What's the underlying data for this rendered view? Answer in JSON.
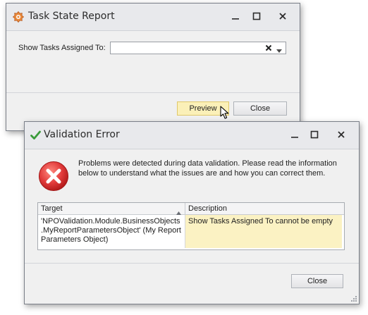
{
  "task_window": {
    "title": "Task State Report",
    "field_label": "Show Tasks Assigned To:",
    "field_value": "",
    "preview_label": "Preview",
    "close_label": "Close"
  },
  "validation_window": {
    "title": "Validation Error",
    "message": "Problems were detected during data validation. Please read the information below to understand what the issues are and how you can correct them.",
    "columns": [
      "Target",
      "Description"
    ],
    "rows": [
      {
        "target": "'NPOValidation.Module.BusinessObjects.MyReportParametersObject' (My Report Parameters Object)",
        "description": "Show Tasks Assigned To cannot be empty"
      }
    ],
    "close_label": "Close"
  },
  "colors": {
    "title_bar": "#e8e9ec",
    "window_body": "#f0f0f0",
    "highlight_row": "#fbf2c3",
    "preview_hover": "#fbf0b8",
    "error_red": "#e23b3b",
    "check_green": "#3a9b3a"
  },
  "icons": {
    "app": "gear-app-icon",
    "validation": "check-icon",
    "error": "error-x-icon",
    "clear": "clear-x-icon",
    "dropdown": "dropdown-arrow-icon",
    "cursor": "mouse-pointer-icon",
    "sort": "sort-ascending-icon",
    "resize": "resize-grip-icon"
  }
}
